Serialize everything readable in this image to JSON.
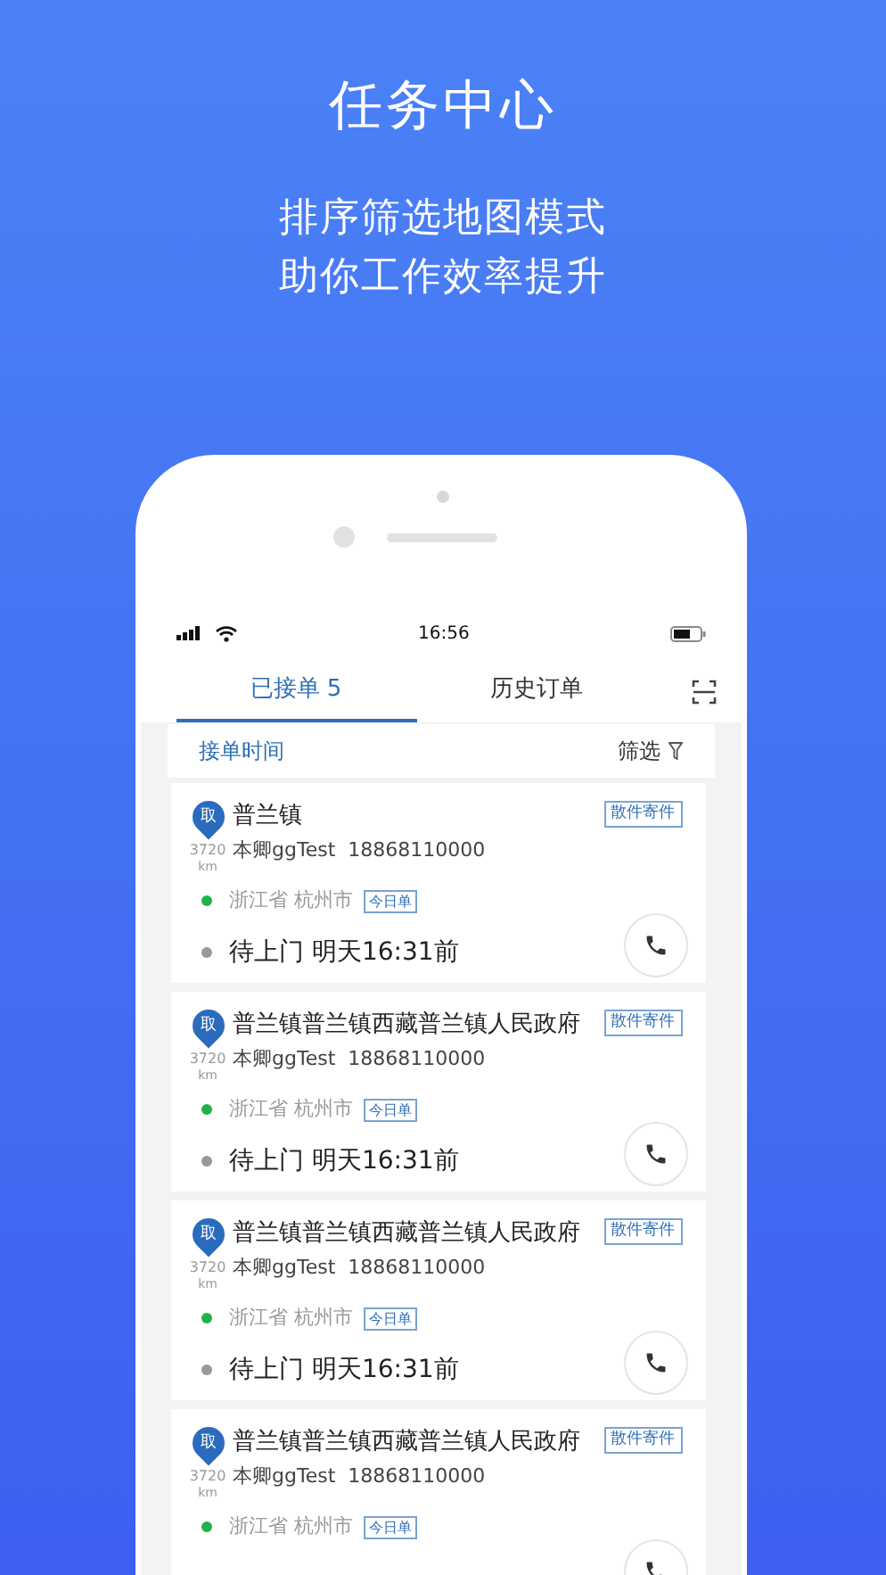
{
  "promo": {
    "title": "任务中心",
    "subtitle_lines": [
      "排序筛选地图模式",
      "助你工作效率提升"
    ]
  },
  "status_bar": {
    "time": "16:56"
  },
  "tabs": [
    {
      "label": "已接单 5",
      "selected": true
    },
    {
      "label": "历史订单",
      "selected": false
    }
  ],
  "filter_bar": {
    "sort": "接单时间",
    "filter": "筛选"
  },
  "orders": [
    {
      "pin": "取",
      "distance": "3720",
      "unit": "km",
      "address": "普兰镇",
      "contact": "本卿ggTest",
      "phone": "18868110000",
      "tag": "散件寄件",
      "province": "浙江省",
      "city": "杭州市",
      "badge": "今日单",
      "status": "待上门",
      "deadline": "明天16:31前"
    },
    {
      "pin": "取",
      "distance": "3720",
      "unit": "km",
      "address": "普兰镇普兰镇西藏普兰镇人民政府",
      "contact": "本卿ggTest",
      "phone": "18868110000",
      "tag": "散件寄件",
      "province": "浙江省",
      "city": "杭州市",
      "badge": "今日单",
      "status": "待上门",
      "deadline": "明天16:31前"
    },
    {
      "pin": "取",
      "distance": "3720",
      "unit": "km",
      "address": "普兰镇普兰镇西藏普兰镇人民政府",
      "contact": "本卿ggTest",
      "phone": "18868110000",
      "tag": "散件寄件",
      "province": "浙江省",
      "city": "杭州市",
      "badge": "今日单",
      "status": "待上门",
      "deadline": "明天16:31前"
    },
    {
      "pin": "取",
      "distance": "3720",
      "unit": "km",
      "address": "普兰镇普兰镇西藏普兰镇人民政府",
      "contact": "本卿ggTest",
      "phone": "18868110000",
      "tag": "散件寄件",
      "province": "浙江省",
      "city": "杭州市",
      "badge": "今日单"
    }
  ]
}
